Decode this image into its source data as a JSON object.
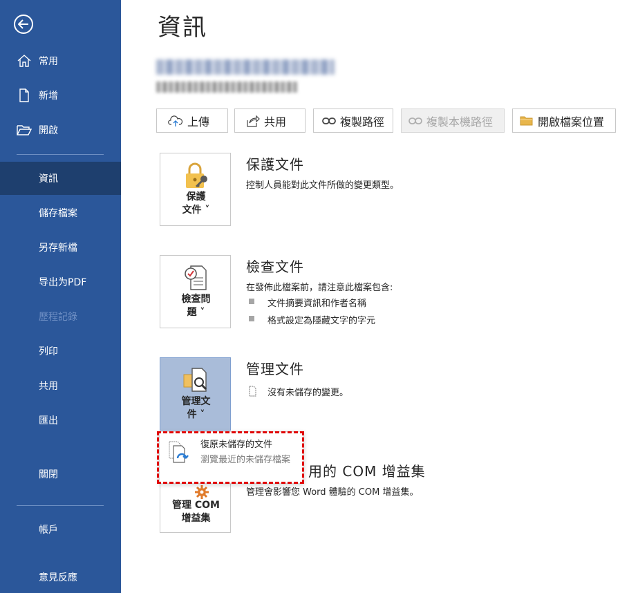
{
  "page_title": "資訊",
  "sidebar": {
    "items": [
      {
        "label": "常用"
      },
      {
        "label": "新增"
      },
      {
        "label": "開啟"
      },
      {
        "label": "資訊"
      },
      {
        "label": "儲存檔案"
      },
      {
        "label": "另存新檔"
      },
      {
        "label": "导出为PDF"
      },
      {
        "label": "歷程記錄"
      },
      {
        "label": "列印"
      },
      {
        "label": "共用"
      },
      {
        "label": "匯出"
      },
      {
        "label": "關閉"
      },
      {
        "label": "帳戶"
      },
      {
        "label": "意見反應"
      }
    ]
  },
  "toolbar": {
    "upload": "上傳",
    "share": "共用",
    "copy_path": "複製路徑",
    "copy_local_path": "複製本機路徑",
    "open_location": "開啟檔案位置"
  },
  "sections": {
    "protect": {
      "button_line1": "保護",
      "button_line2": "文件 ˅",
      "title": "保護文件",
      "desc": "控制人員能對此文件所做的變更類型。"
    },
    "inspect": {
      "button_line1": "檢查問",
      "button_line2": "題 ˅",
      "title": "檢查文件",
      "desc": "在發佈此檔案前，請注意此檔案包含:",
      "bullets": [
        "文件摘要資訊和作者名稱",
        "格式設定為隱藏文字的字元"
      ]
    },
    "manage": {
      "button_line1": "管理文",
      "button_line2": "件 ˅",
      "title": "管理文件",
      "desc": "沒有未儲存的變更。"
    },
    "com": {
      "button_line1": "管理 COM",
      "button_line2": "增益集",
      "title_visible": "用的 COM 增益集",
      "desc": "管理會影響您 Word 體驗的 COM 增益集。"
    }
  },
  "dropdown": {
    "title": "復原未儲存的文件",
    "desc": "瀏覽最近的未儲存檔案"
  }
}
